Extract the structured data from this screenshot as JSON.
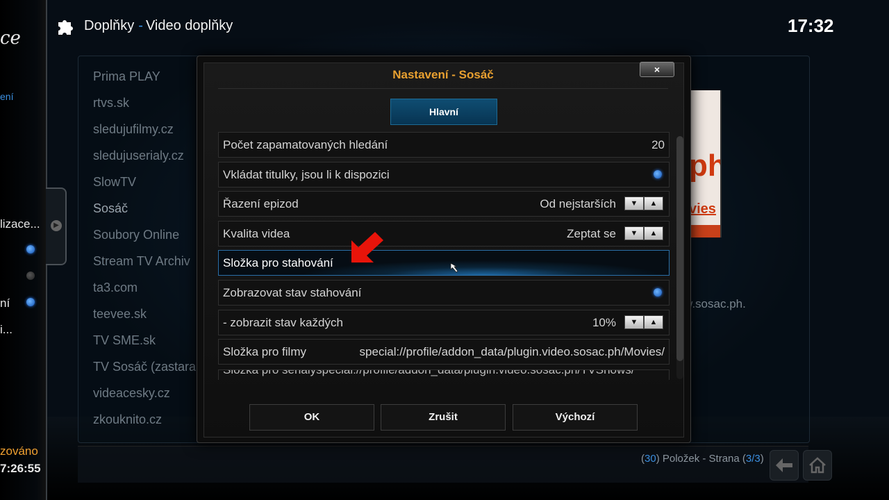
{
  "header": {
    "section": "Doplňky",
    "separator": "-",
    "subsection": "Video doplňky",
    "clock": "17:32"
  },
  "sidebar": {
    "logo_fragment": "ce",
    "blue_fragment": "ení",
    "items": [
      "lizace...",
      "ní",
      "i..."
    ],
    "status_orange": "zováno",
    "status_time": "7:26:55"
  },
  "list": {
    "items": [
      "Prima PLAY",
      "rtvs.sk",
      "sledujufilmy.cz",
      "sledujuserialy.cz",
      "SlowTV",
      "Sosáč",
      "Soubory Online",
      "Stream TV Archiv",
      "ta3.com",
      "teevee.sk",
      "TV SME.sk",
      "TV Sosáč (zastaral",
      "videacesky.cz",
      "zkouknito.cz"
    ],
    "selected_index": 5,
    "thumb_text1": "ph",
    "thumb_text2": "vies",
    "url_fragment": "w.sosac.ph.",
    "count_open": "(",
    "count": "30",
    "count_text": ") Položek - Strana (",
    "page": "3/3",
    "count_close": ")"
  },
  "dialog": {
    "title": "Nastavení - Sosáč",
    "close_label": "×",
    "tab": "Hlavní",
    "settings": [
      {
        "label": "Počet zapamatovaných hledání",
        "value": "20"
      },
      {
        "label": "Vkládat titulky, jsou li k dispozici",
        "value": ""
      },
      {
        "label": "Řazení epizod",
        "value": "Od nejstarších"
      },
      {
        "label": "Kvalita videa",
        "value": "Zeptat se"
      },
      {
        "label": "Složka pro stahování",
        "value": ""
      },
      {
        "label": "Zobrazovat stav stahování",
        "value": ""
      },
      {
        "label": " - zobrazit stav každých",
        "value": "10%"
      },
      {
        "label": "Složka pro filmy",
        "value": "special://profile/addon_data/plugin.video.sosac.ph/Movies/"
      },
      {
        "label": "Složka pro seriály",
        "value": "special://profile/addon_data/plugin.video.sosac.ph/TVShows/"
      }
    ],
    "buttons": {
      "ok": "OK",
      "cancel": "Zrušit",
      "default": "Výchozí"
    },
    "spin_down": "▼",
    "spin_up": "▲"
  },
  "colors": {
    "accent_blue": "#3b8fe0",
    "title_orange": "#e8a030",
    "annotation_red": "#e8140a"
  }
}
